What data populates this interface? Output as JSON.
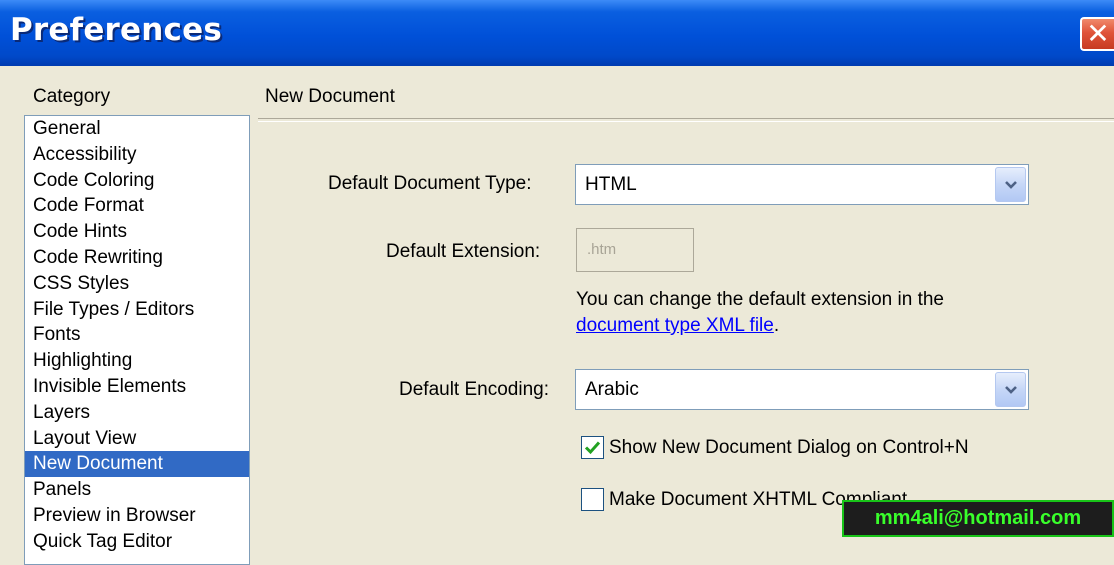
{
  "window": {
    "title": "Preferences",
    "close_glyph": "✕"
  },
  "sidebar": {
    "label": "Category",
    "items": [
      {
        "label": "General"
      },
      {
        "label": "Accessibility"
      },
      {
        "label": "Code Coloring"
      },
      {
        "label": "Code Format"
      },
      {
        "label": "Code Hints"
      },
      {
        "label": "Code Rewriting"
      },
      {
        "label": "CSS Styles"
      },
      {
        "label": "File Types / Editors"
      },
      {
        "label": "Fonts"
      },
      {
        "label": "Highlighting"
      },
      {
        "label": "Invisible Elements"
      },
      {
        "label": "Layers"
      },
      {
        "label": "Layout View"
      },
      {
        "label": "New Document",
        "selected": true
      },
      {
        "label": "Panels"
      },
      {
        "label": "Preview in Browser"
      },
      {
        "label": "Quick Tag Editor"
      }
    ]
  },
  "section": {
    "title": "New Document"
  },
  "form": {
    "doc_type_label": "Default Document Type:",
    "doc_type_value": "HTML",
    "extension_label": "Default Extension:",
    "extension_value": ".htm",
    "info_line1": "You can change the default extension in the",
    "info_link": "document type XML file",
    "info_period": ".",
    "encoding_label": "Default Encoding:",
    "encoding_value": "Arabic",
    "show_dialog_label": "Show New Document Dialog on Control+N",
    "show_dialog_checked": true,
    "xhtml_label": "Make Document XHTML Compliant",
    "xhtml_checked": false
  },
  "watermark": {
    "text": "mm4ali@hotmail.com"
  },
  "colors": {
    "title_bar": "#0050d8",
    "selection": "#316ac5",
    "link": "#0000ff",
    "check": "#21a121",
    "watermark_text": "#39ff2b"
  }
}
